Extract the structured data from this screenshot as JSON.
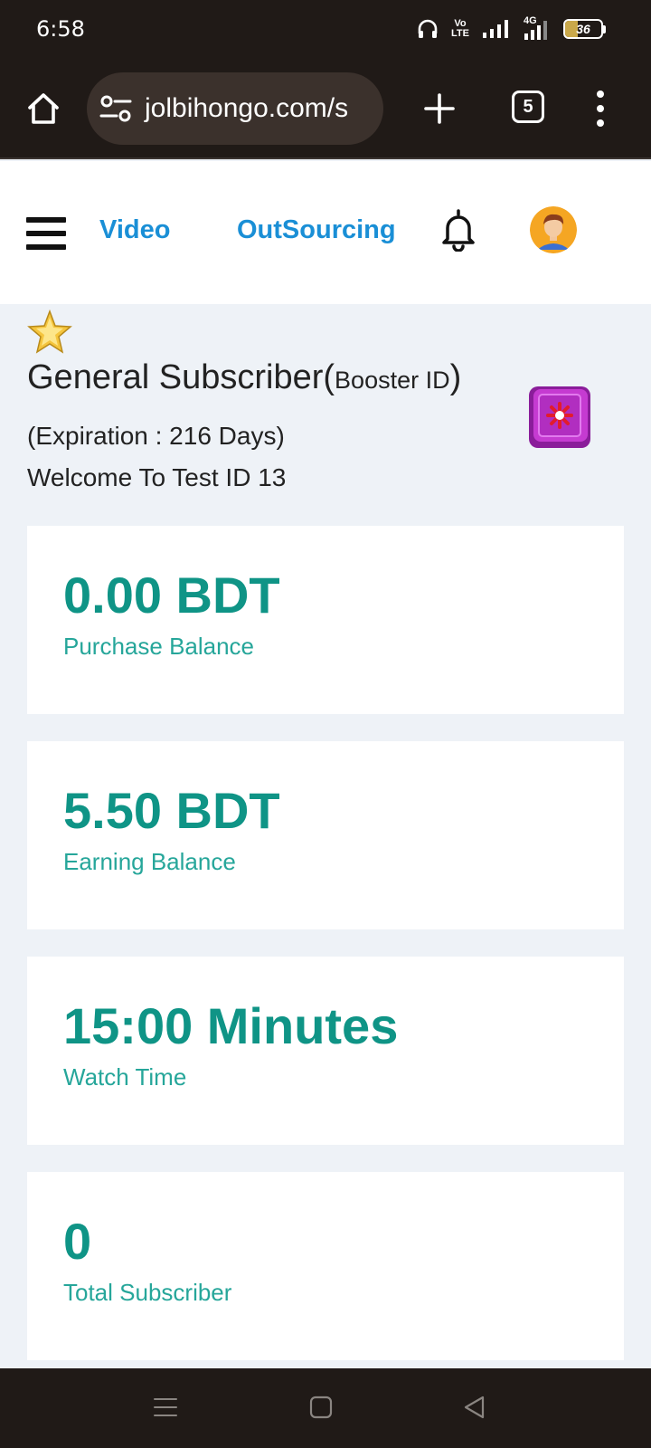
{
  "status_bar": {
    "time": "6:58",
    "volte_top": "Vo",
    "volte_bottom": "LTE",
    "network": "4G",
    "battery": "36",
    "battery_level": 0.36,
    "icons": [
      "headphones-icon",
      "volte-icon",
      "signal-icon",
      "signal-4g-icon",
      "battery-icon"
    ]
  },
  "browser": {
    "url": "jolbihongo.com/s",
    "tab_count": "5",
    "icons": [
      "home-icon",
      "site-settings-icon",
      "plus-icon",
      "tabs-icon",
      "more-vert-icon"
    ]
  },
  "header": {
    "nav_video": "Video",
    "nav_outsourcing": "OutSourcing",
    "icons": [
      "menu-icon",
      "bell-icon",
      "avatar-icon"
    ]
  },
  "profile": {
    "title": "General Subscriber",
    "title_sub": "Booster ID",
    "expiration": "(Expiration : 216 Days)",
    "welcome": "Welcome To Test ID 13",
    "icons": [
      "star-icon",
      "booster-icon"
    ]
  },
  "cards": [
    {
      "value": "0.00 BDT",
      "label": "Purchase Balance"
    },
    {
      "value": "5.50 BDT",
      "label": "Earning Balance"
    },
    {
      "value": "15:00 Minutes",
      "label": "Watch Time"
    },
    {
      "value": "0",
      "label": "Total Subscriber"
    }
  ],
  "colors": {
    "accent_teal": "#0f9486",
    "nav_blue": "#1a8fd6",
    "page_bg": "#eef2f7",
    "bar_dark": "#201a17"
  }
}
